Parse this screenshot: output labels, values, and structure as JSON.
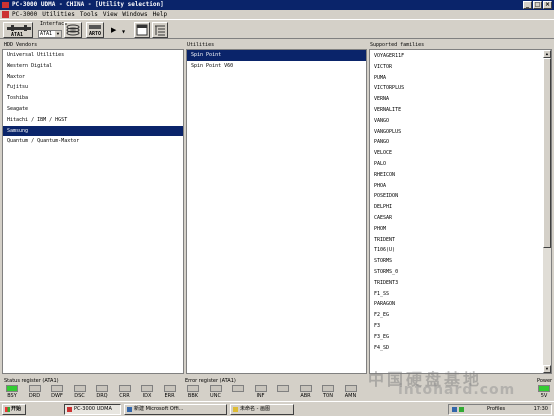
{
  "window": {
    "title": "PC-3000 UDMA - CHINA - [Utility selection]"
  },
  "menu": [
    "PC-3000",
    "Utilities",
    "Tools",
    "View",
    "Windows",
    "Help"
  ],
  "toolbar": {
    "interface_label": "Interface",
    "interface_value": "ATA1",
    "ata1_label": "ATA1",
    "arto_label": "ARTO"
  },
  "hdd_vendors": {
    "header": "HDD Vendors",
    "items": [
      "Universal Utilities",
      "Western Digital",
      "Maxtor",
      "Fujitsu",
      "Toshiba",
      "Seagate",
      "Hitachi / IBM / HGST",
      "Samsung",
      "Quantum / Quantum-Maxtor"
    ],
    "selected": "Samsung"
  },
  "utilities": {
    "header": "Utilities",
    "items": [
      "Spin Point",
      "Spin Point V60"
    ],
    "selected": "Spin Point"
  },
  "families": {
    "header": "Supported families",
    "items": [
      "VOYAGER11F",
      "VICTOR",
      "PUMA",
      "VICTORPLUS",
      "VERNA",
      "VERNALITE",
      "VANGO",
      "VANGOPLUS",
      "PANGO",
      "VELOCE",
      "PALO",
      "RHEICON",
      "PHOA",
      "POSEIDON",
      "DELPHI",
      "CAESAR",
      "PHOM",
      "TRIDENT",
      "T106(U)",
      "STORMS",
      "STORMS_0",
      "TRIDENT3",
      "F1_SS",
      "PARAGON",
      "F2_EG",
      "F3",
      "F3_EG",
      "F4_SD"
    ]
  },
  "status": {
    "register_label": "Status register (ATA1)",
    "error_label": "Error register (ATA1)",
    "power_label": "Power",
    "status_leds": [
      {
        "label": "BSY",
        "on": true
      },
      {
        "label": "DRD",
        "on": false
      },
      {
        "label": "DWF",
        "on": false
      },
      {
        "label": "DSC",
        "on": false
      },
      {
        "label": "DRQ",
        "on": false
      },
      {
        "label": "CRR",
        "on": false
      },
      {
        "label": "IDX",
        "on": false
      },
      {
        "label": "ERR",
        "on": false
      }
    ],
    "error_leds": [
      {
        "label": "BBK",
        "on": false
      },
      {
        "label": "UNC",
        "on": false
      },
      {
        "label": "",
        "on": false
      },
      {
        "label": "INF",
        "on": false
      },
      {
        "label": "",
        "on": false
      },
      {
        "label": "ABR",
        "on": false
      },
      {
        "label": "T0N",
        "on": false
      },
      {
        "label": "AMN",
        "on": false
      }
    ],
    "power_led": {
      "label": "5V",
      "on": true
    },
    "colors": {
      "on": "#33cc33",
      "off": "#c8c4bc"
    }
  },
  "watermark": {
    "text": "intohard.com",
    "text_cn": "中国硬盘基地"
  },
  "taskbar": {
    "start": "开始",
    "tasks": [
      "PC-3000 UDMA",
      "新建 Microsoft Offi...",
      "未命名 - 画图"
    ],
    "tray_profile": "Profiles",
    "clock": "17:30"
  }
}
